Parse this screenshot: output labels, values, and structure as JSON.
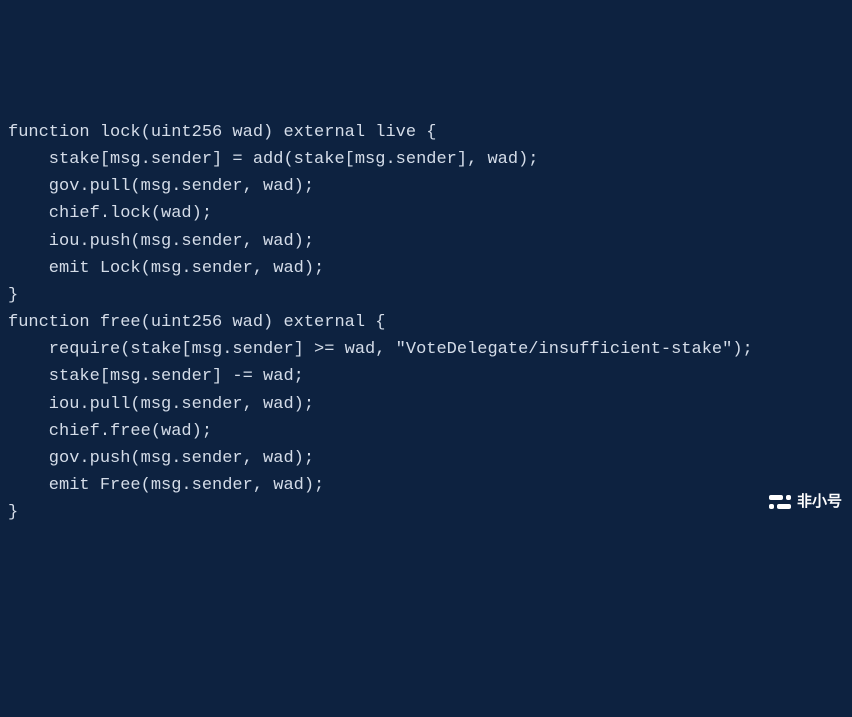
{
  "code": {
    "lines": [
      "function lock(uint256 wad) external live {",
      "    stake[msg.sender] = add(stake[msg.sender], wad);",
      "    gov.pull(msg.sender, wad);",
      "    chief.lock(wad);",
      "    iou.push(msg.sender, wad);",
      "",
      "    emit Lock(msg.sender, wad);",
      "}",
      "",
      "function free(uint256 wad) external {",
      "    require(stake[msg.sender] >= wad, \"VoteDelegate/insufficient-stake\");",
      "",
      "    stake[msg.sender] -= wad;",
      "    iou.pull(msg.sender, wad);",
      "    chief.free(wad);",
      "    gov.push(msg.sender, wad);",
      "",
      "    emit Free(msg.sender, wad);",
      "}"
    ]
  },
  "watermark": {
    "text": "非小号"
  }
}
